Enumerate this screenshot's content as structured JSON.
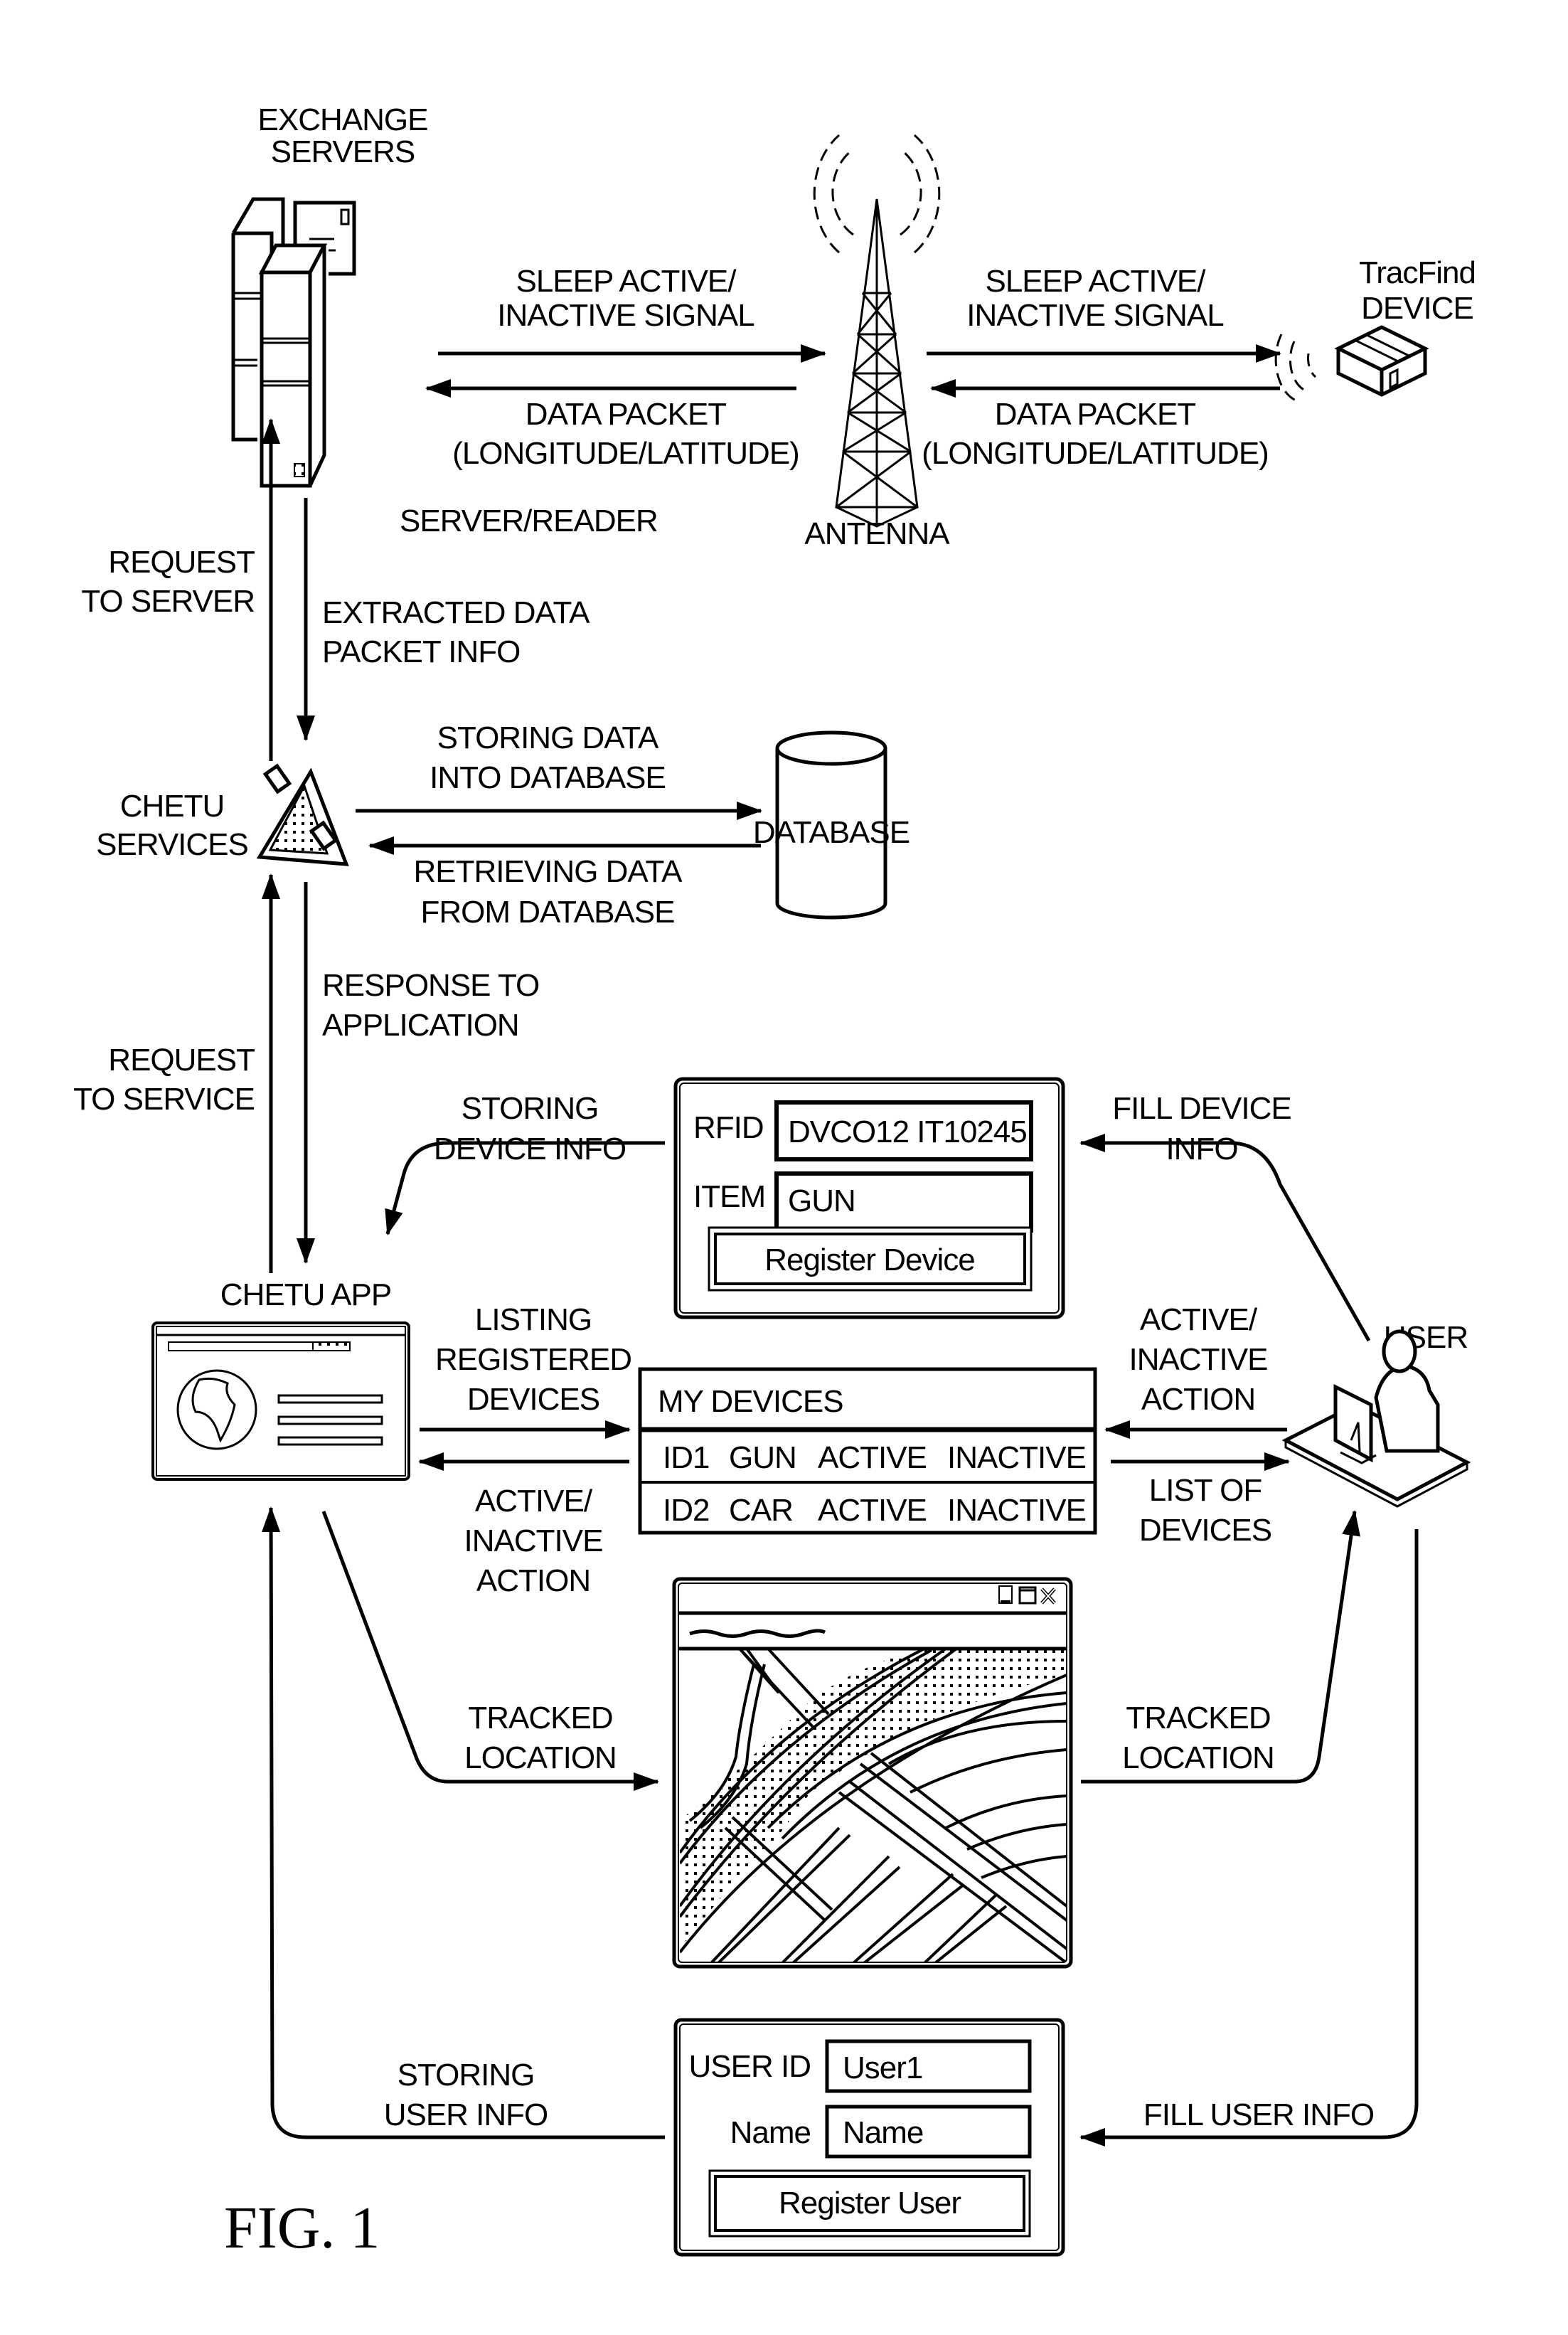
{
  "figure": {
    "caption": "FIG. 1"
  },
  "nodes": {
    "exchange_servers": {
      "label_lines": [
        "EXCHANGE",
        "SERVERS"
      ],
      "sub_label": "SERVER/READER"
    },
    "antenna": {
      "label": "ANTENNA"
    },
    "tracfind_device": {
      "label_lines": [
        "TracFind",
        "DEVICE"
      ]
    },
    "chetu_services": {
      "label_lines": [
        "CHETU",
        "SERVICES"
      ]
    },
    "database": {
      "label": "DATABASE"
    },
    "chetu_app": {
      "label": "CHETU APP"
    },
    "user": {
      "label": "USER"
    }
  },
  "flows": {
    "server_to_antenna": [
      "SLEEP ACTIVE/",
      "INACTIVE SIGNAL"
    ],
    "antenna_to_server": [
      "DATA PACKET",
      "(LONGITUDE/LATITUDE)"
    ],
    "antenna_to_device": [
      "SLEEP ACTIVE/",
      "INACTIVE SIGNAL"
    ],
    "device_to_antenna": [
      "DATA PACKET",
      "(LONGITUDE/LATITUDE)"
    ],
    "request_to_server": [
      "REQUEST",
      "TO SERVER"
    ],
    "extracted_data": [
      "EXTRACTED DATA",
      "PACKET INFO"
    ],
    "storing_db": [
      "STORING DATA",
      "INTO DATABASE"
    ],
    "retrieving_db": [
      "RETRIEVING DATA",
      "FROM DATABASE"
    ],
    "response_to_app": [
      "RESPONSE TO",
      "APPLICATION"
    ],
    "request_to_service": [
      "REQUEST",
      "TO SERVICE"
    ],
    "storing_device_info": [
      "STORING",
      "DEVICE INFO"
    ],
    "fill_device_info": [
      "FILL DEVICE",
      "INFO"
    ],
    "listing_registered": [
      "LISTING",
      "REGISTERED",
      "DEVICES"
    ],
    "app_active_inactive": [
      "ACTIVE/",
      "INACTIVE",
      "ACTION"
    ],
    "user_active_inactive": [
      "ACTIVE/",
      "INACTIVE",
      "ACTION"
    ],
    "list_of_devices": [
      "LIST OF",
      "DEVICES"
    ],
    "tracked_location_left": [
      "TRACKED",
      "LOCATION"
    ],
    "tracked_location_right": [
      "TRACKED",
      "LOCATION"
    ],
    "storing_user_info": [
      "STORING",
      "USER INFO"
    ],
    "fill_user_info": [
      "FILL USER INFO"
    ]
  },
  "device_form": {
    "rfid_label": "RFID",
    "rfid_value": "DVCO12 IT10245",
    "item_label": "ITEM",
    "item_value": "GUN",
    "submit_label": "Register Device"
  },
  "my_devices": {
    "title": "MY DEVICES",
    "rows": [
      {
        "id": "ID1",
        "item": "GUN",
        "active": "ACTIVE",
        "inactive": "INACTIVE"
      },
      {
        "id": "ID2",
        "item": "CAR",
        "active": "ACTIVE",
        "inactive": "INACTIVE"
      }
    ]
  },
  "map_window": {
    "controls": [
      "minimize",
      "maximize",
      "close"
    ]
  },
  "user_form": {
    "user_id_label": "USER ID",
    "user_id_value": "User1",
    "name_label": "Name",
    "name_value": "Name",
    "submit_label": "Register User"
  }
}
